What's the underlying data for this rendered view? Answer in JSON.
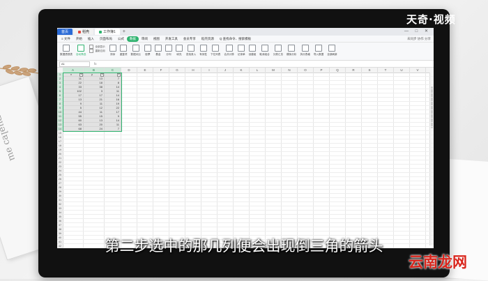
{
  "watermark_top": "天奇·视频",
  "subtitle": "第二步选中的那几列便会出现倒三角的箭头",
  "watermark_bottom": "云南龙网",
  "titlebar": {
    "tabs": [
      {
        "label": "首页"
      },
      {
        "label": "稻壳"
      },
      {
        "label": "工作簿1"
      }
    ],
    "new_tab": "+",
    "window_controls": "— □ ✕"
  },
  "menubar": {
    "items": [
      "≡ 文件",
      "开始",
      "插入",
      "页面布局",
      "公式",
      "数据",
      "审阅",
      "视图",
      "开发工具",
      "会员专享",
      "稻壳资源",
      "Q 查找命令、搜索模板"
    ],
    "selected_index": 5,
    "right": "未同步 协作 分享"
  },
  "ribbon": {
    "buttons": [
      "数据透视表",
      "自动筛选",
      "排序",
      "重复项",
      "数据对比",
      "股票",
      "基金",
      "分列",
      "填充",
      "查找录入",
      "有效性",
      "下拉列表",
      "合并计算",
      "记录单",
      "创建组",
      "取消组合",
      "分类汇总",
      "模拟分析",
      "拆分表格",
      "导入数据",
      "全部刷新"
    ],
    "highlight_index": 1,
    "sub_group": [
      "全部显示",
      "重新应用"
    ]
  },
  "formulabar": {
    "namebox": "A1",
    "fx": "fx"
  },
  "columns": [
    "A",
    "B",
    "C",
    "D",
    "E",
    "F",
    "G",
    "H",
    "I",
    "J",
    "K",
    "L",
    "M",
    "N",
    "O",
    "P",
    "Q",
    "R",
    "S",
    "T",
    "U",
    "V"
  ],
  "rows": [
    "1",
    "2",
    "3",
    "4",
    "5",
    "6",
    "7",
    "8",
    "9",
    "10",
    "11",
    "12",
    "13",
    "14",
    "15",
    "16",
    "17",
    "18",
    "19",
    "20",
    "21",
    "22",
    "23",
    "24",
    "25",
    "26",
    "27",
    "28",
    "29",
    "30",
    "31",
    "32",
    "33",
    "34",
    "35",
    "36",
    "37",
    "38",
    "39",
    "40",
    "41",
    "42"
  ],
  "table": {
    "headers": [
      "x",
      "y",
      ""
    ],
    "values": [
      [
        "11",
        "13",
        "7"
      ],
      [
        "22",
        "18",
        "8"
      ],
      [
        "33",
        "38",
        "14"
      ],
      [
        "102",
        "3",
        "11"
      ],
      [
        "17",
        "17",
        "14"
      ],
      [
        "13",
        "21",
        "16"
      ],
      [
        "9",
        "11",
        "19"
      ],
      [
        "5",
        "12",
        "22"
      ],
      [
        "44",
        "11",
        "17"
      ],
      [
        "55",
        "15",
        "9"
      ],
      [
        "60",
        "13",
        "14"
      ],
      [
        "63",
        "20",
        "11"
      ],
      [
        "68",
        "24",
        "7"
      ]
    ]
  }
}
